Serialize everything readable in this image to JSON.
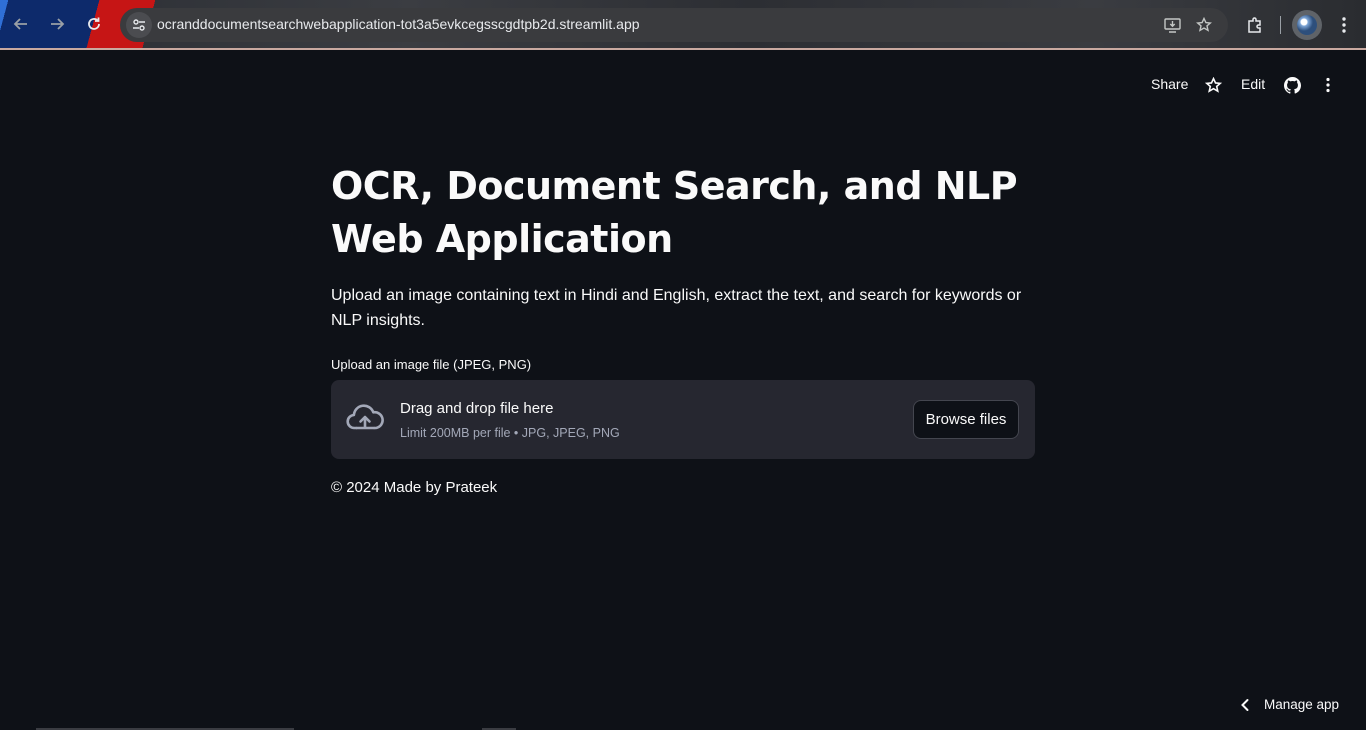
{
  "browser": {
    "url": "ocranddocumentsearchwebapplication-tot3a5evkcegsscgdtpb2d.streamlit.app",
    "icons": [
      "back-arrow-icon",
      "forward-arrow-icon",
      "reload-icon",
      "site-settings-icon",
      "install-app-icon",
      "bookmark-star-icon",
      "extensions-icon",
      "profile-avatar",
      "kebab-menu-icon"
    ]
  },
  "header": {
    "share_label": "Share",
    "edit_label": "Edit",
    "icons": [
      "star-icon",
      "github-icon",
      "more-menu-icon"
    ]
  },
  "main": {
    "title": "OCR, Document Search, and NLP Web Application",
    "description": "Upload an image containing text in Hindi and English, extract the text, and search for keywords or NLP insights.",
    "uploader": {
      "label": "Upload an image file (JPEG, PNG)",
      "drop_title": "Drag and drop file here",
      "drop_subtitle": "Limit 200MB per file • JPG, JPEG, PNG",
      "browse_label": "Browse files"
    },
    "footer": "© 2024 Made by Prateek"
  },
  "manage_app": {
    "label": "Manage app"
  },
  "colors": {
    "background": "#0e1117",
    "dropzone": "#262730",
    "muted_text": "#a3a8b8"
  }
}
